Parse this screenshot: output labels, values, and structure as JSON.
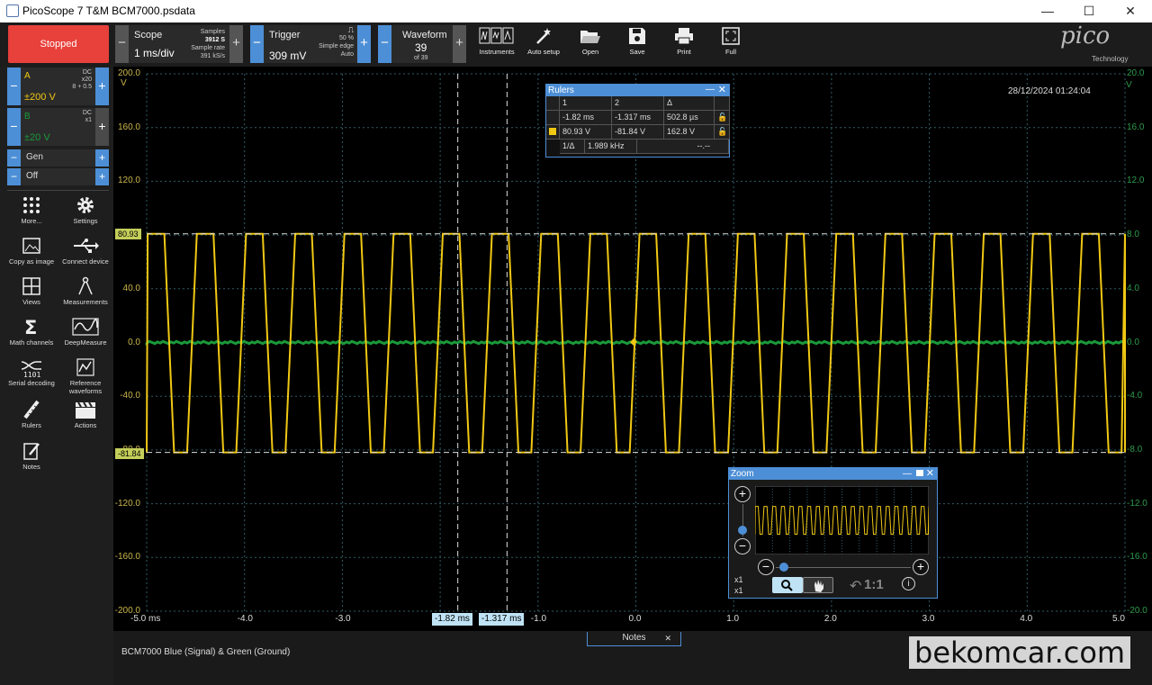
{
  "window": {
    "title": "PicoScope 7 T&M BCM7000.psdata",
    "minimize": "—",
    "maximize": "☐",
    "close": "✕"
  },
  "toolbar": {
    "stop_label": "Stopped",
    "scope": {
      "label": "Scope",
      "value": "1 ms/div",
      "samples_label": "Samples",
      "samples_value": "3912 S",
      "rate_label": "Sample rate",
      "rate_value": "391 kS/s"
    },
    "trigger": {
      "label": "Trigger",
      "value": "309 mV",
      "percent": "50 %",
      "type": "Simple edge",
      "mode": "Auto"
    },
    "waveform": {
      "label": "Waveform",
      "value": "39",
      "of": "of 39"
    },
    "tools": [
      "Instruments",
      "Auto setup",
      "Open",
      "Save",
      "Print",
      "Full"
    ],
    "logo_text": "pico",
    "logo_sub": "Technology"
  },
  "channels": [
    {
      "name": "A",
      "coupling": "DC",
      "probe": "x20",
      "extra": "8 + 0.5",
      "range": "±200 V",
      "color": "#f0c814"
    },
    {
      "name": "B",
      "coupling": "DC",
      "probe": "x1",
      "range": "±20 V",
      "color": "#1a9a3a"
    }
  ],
  "gen": {
    "label": "Gen",
    "off": "Off"
  },
  "side_tools": [
    "More...",
    "Settings",
    "Copy as image",
    "Connect device",
    "Views",
    "Measurements",
    "Math channels",
    "DeepMeasure",
    "Serial decoding",
    "Reference waveforms",
    "Rulers",
    "Actions",
    "Notes"
  ],
  "scope": {
    "timestamp": "28/12/2024 01:24:04",
    "y_left": [
      "200.0",
      "160.0",
      "120.0",
      "80.0",
      "40.0",
      "0.0",
      "-40.0",
      "-80.0",
      "-120.0",
      "-160.0",
      "-200.0"
    ],
    "y_right": [
      "20.0",
      "16.0",
      "12.0",
      "8.0",
      "4.0",
      "0.0",
      "-4.0",
      "-8.0",
      "-12.0",
      "-16.0",
      "-20.0"
    ],
    "y_unit": "V",
    "x_labels": [
      "-5.0 ms",
      "-4.0",
      "-3.0",
      "-2.0",
      "-1.0",
      "0.0",
      "1.0",
      "2.0",
      "3.0",
      "4.0",
      "5.0"
    ],
    "ruler_upper": "80.93",
    "ruler_lower": "-81.84",
    "ruler_t1": "-1.82 ms",
    "ruler_t2": "-1.317 ms"
  },
  "rulers": {
    "title": "Rulers",
    "col1": "1",
    "col2": "2",
    "delta": "Δ",
    "t1": "-1.82 ms",
    "t2": "-1.317 ms",
    "dt": "502.8 µs",
    "v1": "80.93 V",
    "v2": "-81.84 V",
    "dv": "162.8 V",
    "inv_label": "1/Δ",
    "freq": "1.989 kHz",
    "freq_other": "--.--"
  },
  "zoom": {
    "title": "Zoom",
    "x1a": "x1",
    "x1b": "x1",
    "ratio": "1:1"
  },
  "bottom": {
    "notes_tab": "Notes",
    "notes_text": "BCM7000 Blue (Signal) & Green (Ground)",
    "watermark": "bekomcar.com"
  },
  "chart_data": {
    "type": "line",
    "xlabel": "",
    "ylabel": "V",
    "xlim": [
      -5.0,
      5.0
    ],
    "ylim": [
      -200,
      200
    ],
    "series": [
      {
        "name": "A",
        "shape": "trapezoid square wave",
        "high": 80.93,
        "low": -81.84,
        "frequency_khz": 1.989,
        "color": "#f0c814"
      },
      {
        "name": "B",
        "shape": "flat noise",
        "level": 0.0,
        "color": "#1a9a3a"
      }
    ]
  }
}
